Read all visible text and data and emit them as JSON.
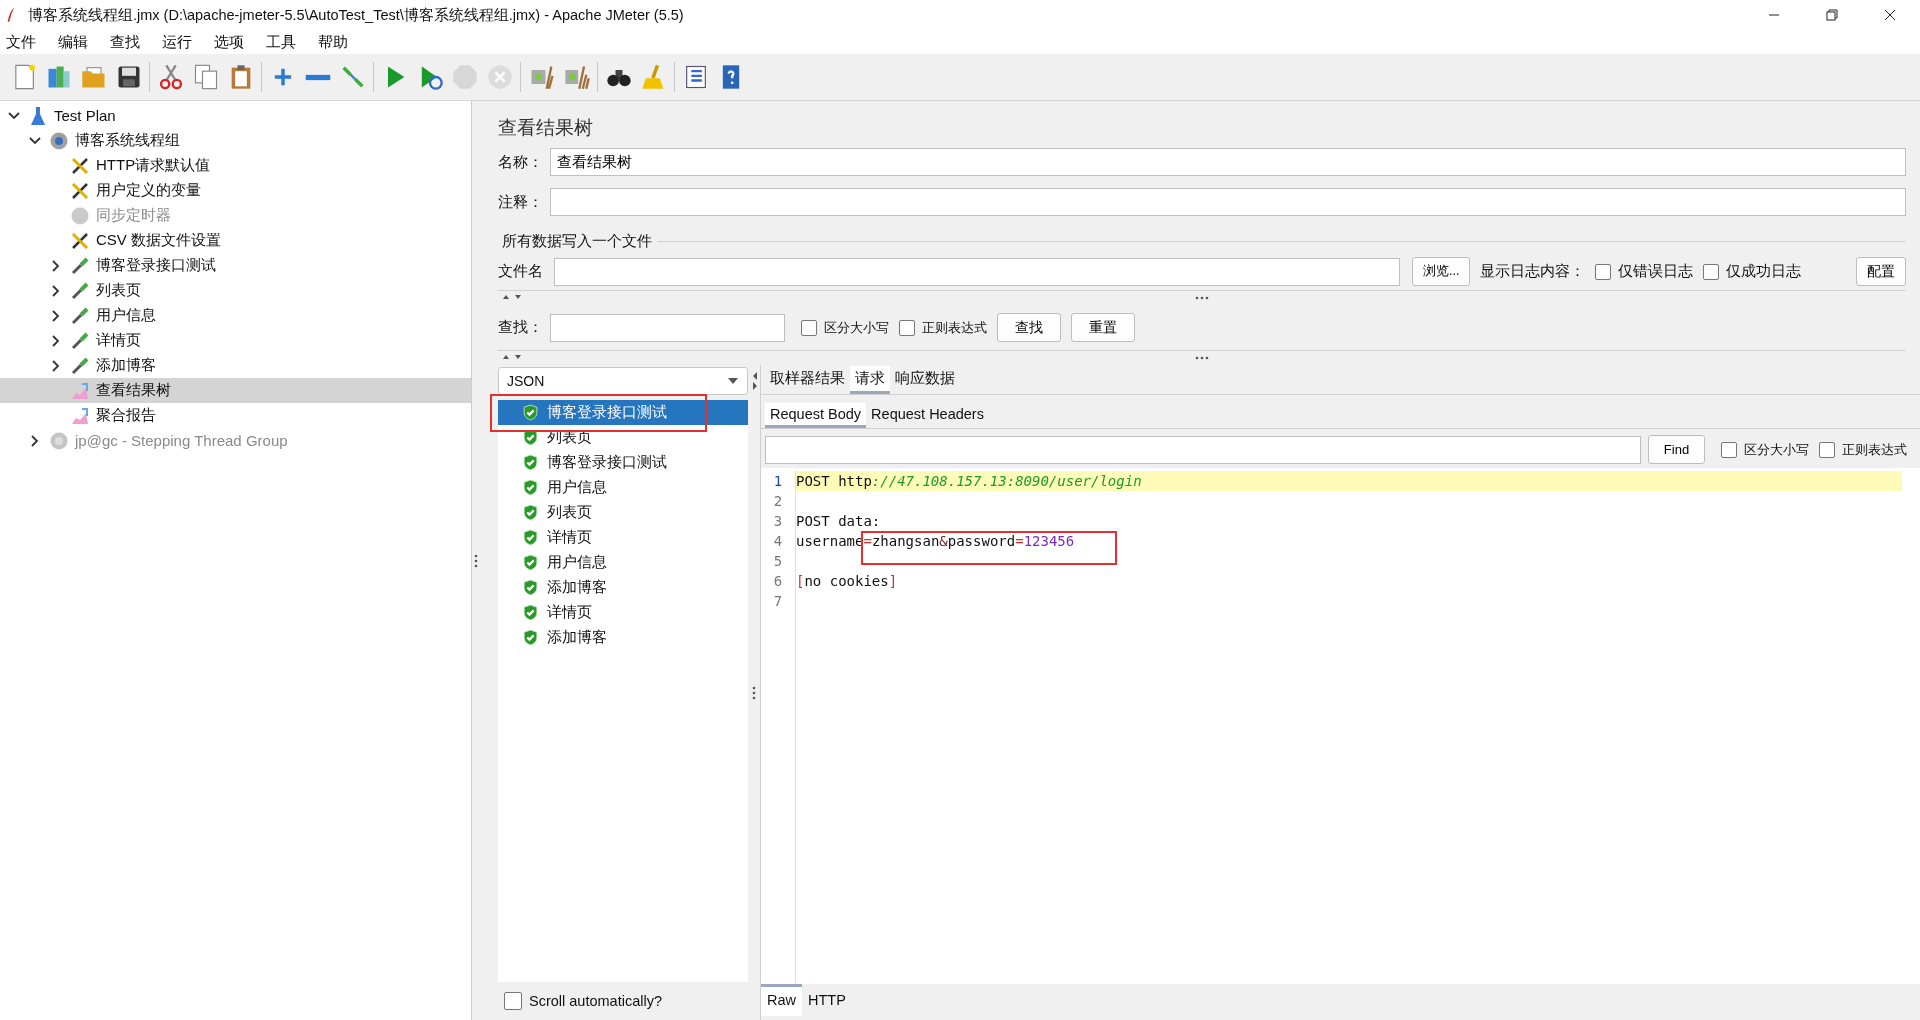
{
  "window": {
    "title": "博客系统线程组.jmx (D:\\apache-jmeter-5.5\\AutoTest_Test\\博客系统线程组.jmx) - Apache JMeter (5.5)"
  },
  "menu": [
    "文件",
    "编辑",
    "查找",
    "运行",
    "选项",
    "工具",
    "帮助"
  ],
  "toolbar": [
    [
      {
        "kind": "new",
        "disabled": false
      },
      {
        "kind": "templates",
        "disabled": false
      },
      {
        "kind": "open",
        "disabled": false
      },
      {
        "kind": "save",
        "disabled": false
      }
    ],
    [
      {
        "kind": "cut",
        "disabled": false
      },
      {
        "kind": "copy",
        "disabled": false
      },
      {
        "kind": "paste",
        "disabled": false
      }
    ],
    [
      {
        "kind": "expand",
        "disabled": false
      },
      {
        "kind": "collapse",
        "disabled": false
      },
      {
        "kind": "toggle",
        "disabled": false
      }
    ],
    [
      {
        "kind": "start",
        "disabled": false
      },
      {
        "kind": "start-no-pause",
        "disabled": false
      },
      {
        "kind": "stop",
        "disabled": true
      },
      {
        "kind": "shutdown",
        "disabled": true
      }
    ],
    [
      {
        "kind": "clear",
        "disabled": false
      },
      {
        "kind": "clear-all",
        "disabled": false
      }
    ],
    [
      {
        "kind": "search",
        "disabled": false
      },
      {
        "kind": "reset-search",
        "disabled": false
      }
    ],
    [
      {
        "kind": "function",
        "disabled": false
      },
      {
        "kind": "help",
        "disabled": false
      }
    ]
  ],
  "tree": [
    {
      "label": "Test Plan",
      "kind": "plan",
      "expanded": true,
      "selected": false,
      "disabled": false,
      "children": [
        {
          "label": "博客系统线程组",
          "kind": "thread-group",
          "expanded": true,
          "selected": false,
          "disabled": false,
          "children": [
            {
              "label": "HTTP请求默认值",
              "kind": "config",
              "selected": false,
              "disabled": false
            },
            {
              "label": "用户定义的变量",
              "kind": "config",
              "selected": false,
              "disabled": false
            },
            {
              "label": "同步定时器",
              "kind": "timer",
              "selected": false,
              "disabled": true
            },
            {
              "label": "CSV 数据文件设置",
              "kind": "config",
              "selected": false,
              "disabled": false
            },
            {
              "label": "博客登录接口测试",
              "kind": "sampler",
              "expanded": false,
              "selected": false,
              "disabled": false
            },
            {
              "label": "列表页",
              "kind": "sampler",
              "expanded": false,
              "selected": false,
              "disabled": false
            },
            {
              "label": "用户信息",
              "kind": "sampler",
              "expanded": false,
              "selected": false,
              "disabled": false
            },
            {
              "label": "详情页",
              "kind": "sampler",
              "expanded": false,
              "selected": false,
              "disabled": false
            },
            {
              "label": "添加博客",
              "kind": "sampler",
              "expanded": false,
              "selected": false,
              "disabled": false
            },
            {
              "label": "查看结果树",
              "kind": "listener",
              "selected": true,
              "disabled": false
            },
            {
              "label": "聚合报告",
              "kind": "listener",
              "selected": false,
              "disabled": false
            }
          ]
        },
        {
          "label": "jp@gc - Stepping Thread Group",
          "kind": "thread-group",
          "expanded": false,
          "selected": false,
          "disabled": true
        }
      ]
    }
  ],
  "panel": {
    "title": "查看结果树",
    "name_label": "名称：",
    "name_value": "查看结果树",
    "comment_label": "注释：",
    "file_section": "所有数据写入一个文件",
    "file_label": "文件名",
    "browse_button": "浏览...",
    "log_label": "显示日志内容：",
    "log_options": [
      {
        "label": "仅错误日志",
        "checked": false
      },
      {
        "label": "仅成功日志",
        "checked": false
      }
    ],
    "config_button": "配置",
    "search_label": "查找：",
    "search_options": [
      {
        "label": "区分大小写",
        "checked": false
      },
      {
        "label": "正则表达式",
        "checked": false
      }
    ],
    "search_button": "查找",
    "reset_button": "重置"
  },
  "results": {
    "renderer": "JSON",
    "items": [
      {
        "label": "博客登录接口测试",
        "ok": true,
        "selected": true,
        "highlighted": true
      },
      {
        "label": "列表页",
        "ok": true,
        "selected": false,
        "highlighted": false
      },
      {
        "label": "博客登录接口测试",
        "ok": true,
        "selected": false,
        "highlighted": false
      },
      {
        "label": "用户信息",
        "ok": true,
        "selected": false,
        "highlighted": false
      },
      {
        "label": "列表页",
        "ok": true,
        "selected": false,
        "highlighted": false
      },
      {
        "label": "详情页",
        "ok": true,
        "selected": false,
        "highlighted": false
      },
      {
        "label": "用户信息",
        "ok": true,
        "selected": false,
        "highlighted": false
      },
      {
        "label": "添加博客",
        "ok": true,
        "selected": false,
        "highlighted": false
      },
      {
        "label": "详情页",
        "ok": true,
        "selected": false,
        "highlighted": false
      },
      {
        "label": "添加博客",
        "ok": true,
        "selected": false,
        "highlighted": false
      }
    ],
    "scroll": {
      "label": "Scroll automatically?",
      "checked": false
    }
  },
  "viewer": {
    "tabs": [
      {
        "label": "取样器结果",
        "selected": false
      },
      {
        "label": "请求",
        "selected": true
      },
      {
        "label": "响应数据",
        "selected": false
      }
    ],
    "subtabs": [
      {
        "label": "Request Body",
        "selected": true
      },
      {
        "label": "Request Headers",
        "selected": false
      }
    ],
    "find_button": "Find",
    "find_options": [
      {
        "label": "区分大小写",
        "checked": false
      },
      {
        "label": "正则表达式",
        "checked": false
      }
    ],
    "lines": [
      {
        "number": "1",
        "current": true,
        "segments": [
          {
            "text": "POST http",
            "kind": "plain"
          },
          {
            "text": "://47.108.157.13:8090/user/login",
            "kind": "url"
          }
        ]
      },
      {
        "number": "2",
        "current": false
      },
      {
        "number": "3",
        "current": false,
        "segments": [
          {
            "text": "POST data:",
            "kind": "plain"
          }
        ]
      },
      {
        "number": "4",
        "current": false,
        "segments": [
          {
            "text": "username",
            "kind": "plain"
          }
        ],
        "boxed": [
          {
            "text": "=",
            "kind": "op"
          },
          {
            "text": "zhangsan",
            "kind": "plain"
          },
          {
            "text": "&",
            "kind": "amp"
          },
          {
            "text": "password",
            "kind": "plain"
          },
          {
            "text": "=",
            "kind": "op"
          },
          {
            "text": "123456",
            "kind": "number"
          }
        ]
      },
      {
        "number": "5",
        "current": false
      },
      {
        "number": "6",
        "current": false,
        "segments": [
          {
            "text": "[",
            "kind": "bracket"
          },
          {
            "text": "no cookies",
            "kind": "plain"
          },
          {
            "text": "]",
            "kind": "bracket"
          }
        ]
      },
      {
        "number": "7",
        "current": false
      }
    ],
    "bottom_tabs": [
      {
        "label": "Raw",
        "selected": true
      },
      {
        "label": "HTTP",
        "selected": false
      }
    ]
  }
}
